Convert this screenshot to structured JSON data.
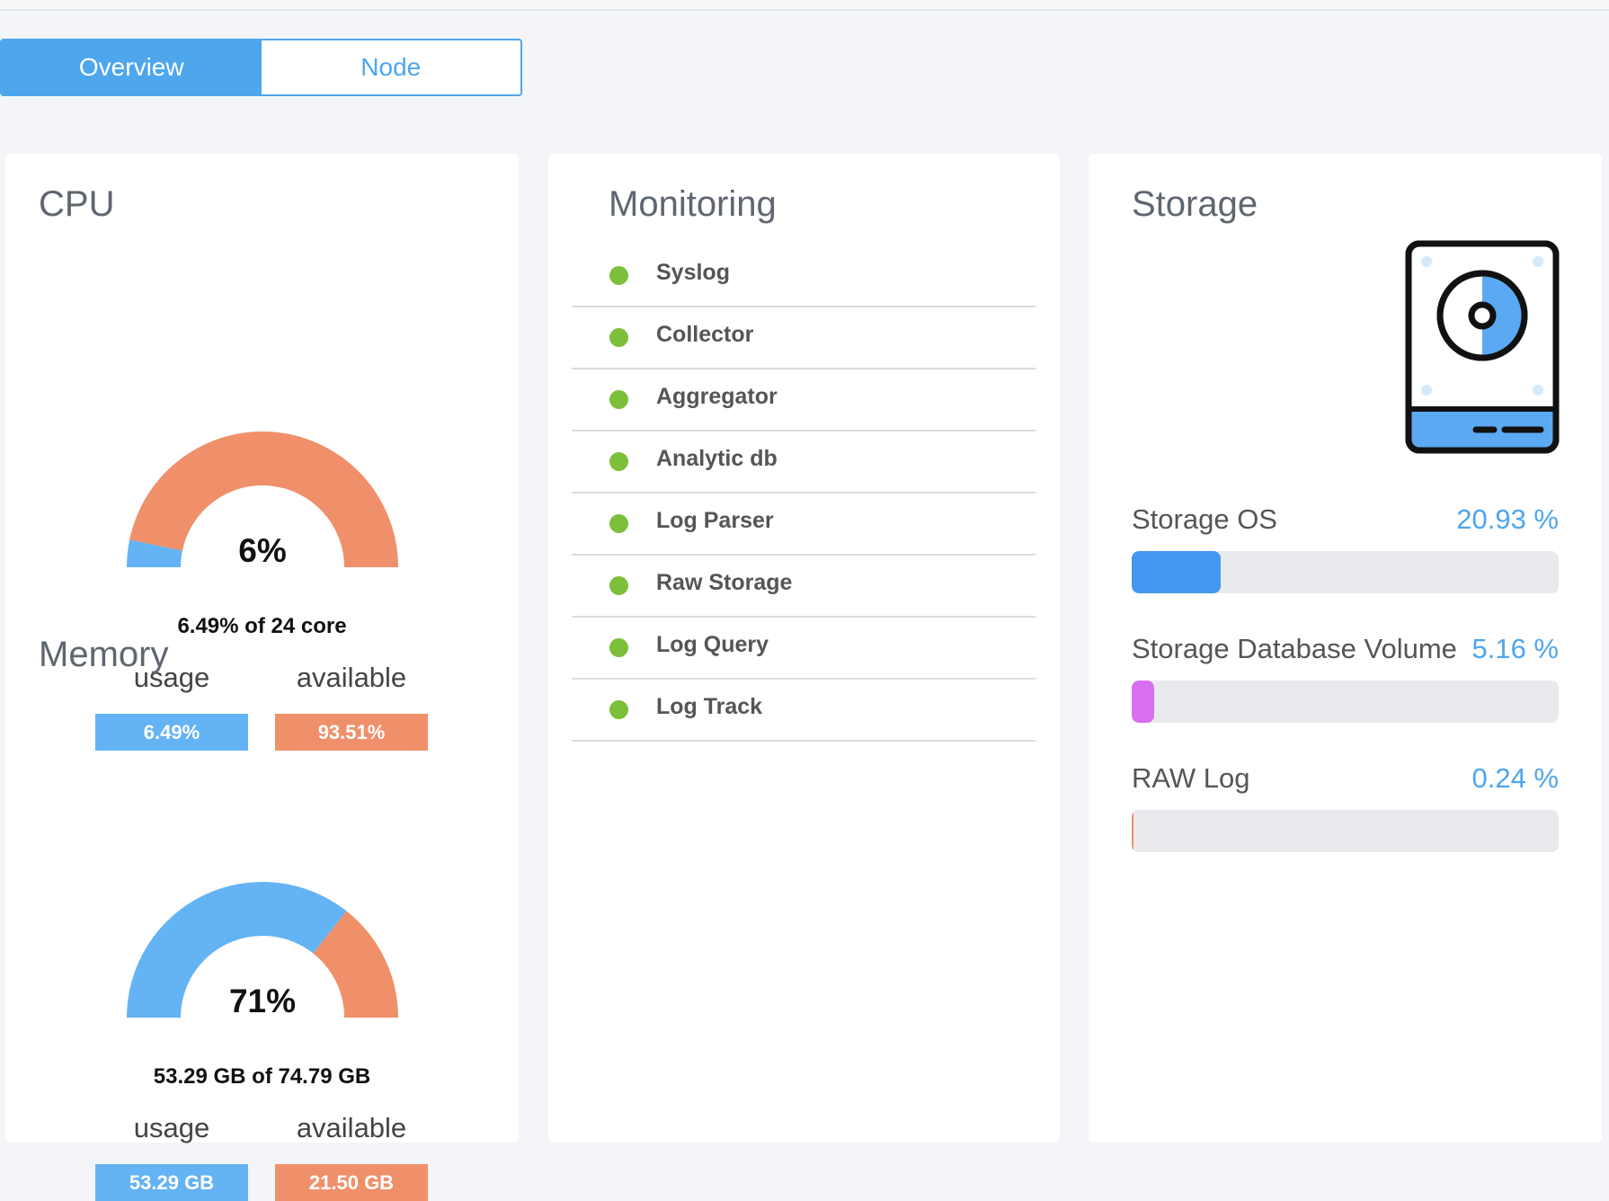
{
  "tabs": [
    {
      "label": "Overview",
      "active": true
    },
    {
      "label": "Node",
      "active": false
    }
  ],
  "cpu": {
    "title": "CPU",
    "gauge_percent_label": "6%",
    "usage_fraction": 0.0649,
    "subtitle": "6.49% of 24 core",
    "usage_label": "usage",
    "available_label": "available",
    "usage_value": "6.49%",
    "available_value": "93.51%"
  },
  "memory": {
    "title": "Memory",
    "gauge_percent_label": "71%",
    "usage_fraction": 0.7126,
    "subtitle": "53.29 GB of 74.79 GB",
    "usage_label": "usage",
    "available_label": "available",
    "usage_value": "53.29 GB",
    "available_value": "21.50 GB"
  },
  "monitoring": {
    "title": "Monitoring",
    "items": [
      {
        "label": "Syslog",
        "status": "ok"
      },
      {
        "label": "Collector",
        "status": "ok"
      },
      {
        "label": "Aggregator",
        "status": "ok"
      },
      {
        "label": "Analytic db",
        "status": "ok"
      },
      {
        "label": "Log Parser",
        "status": "ok"
      },
      {
        "label": "Raw Storage",
        "status": "ok"
      },
      {
        "label": "Log Query",
        "status": "ok"
      },
      {
        "label": "Log Track",
        "status": "ok"
      }
    ]
  },
  "storage": {
    "title": "Storage",
    "icon": "hard-disk-icon",
    "items": [
      {
        "label": "Storage OS",
        "value": "20.93 %",
        "fraction": 0.2093,
        "color": "#4497f0"
      },
      {
        "label": "Storage Database Volume",
        "value": "5.16 %",
        "fraction": 0.0516,
        "color": "#d86ef0"
      },
      {
        "label": "RAW Log",
        "value": "0.24 %",
        "fraction": 0.0024,
        "color": "#f0906a"
      }
    ]
  },
  "colors": {
    "accent": "#4ea6ec",
    "usage": "#64b3f4",
    "available": "#f0906a",
    "status_ok": "#7cbf3a"
  }
}
